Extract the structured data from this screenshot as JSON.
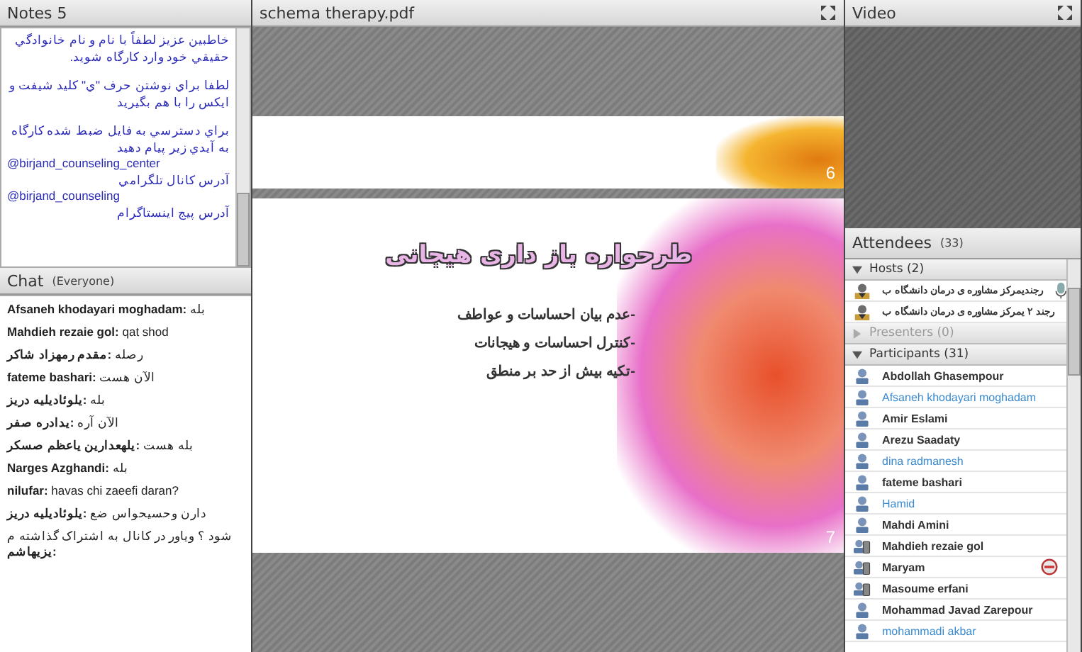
{
  "notes": {
    "title": "Notes 5",
    "paragraphs": [
      {
        "kind": "rtl",
        "text": "خاطبين عزيز لطفاً با نام و نام خانوادگي حقيقي خود وارد کارگاه شويد."
      },
      {
        "kind": "gap"
      },
      {
        "kind": "rtl",
        "text": "لطفا براي نوشتن حرف \"ي\" کليد شيفت و ايکس را با هم بگيريد"
      },
      {
        "kind": "gap"
      },
      {
        "kind": "rtl",
        "text": "براي دسترسي به فايل ضبط شده کارگاه به آيدي زير پيام دهيد"
      },
      {
        "kind": "ltr",
        "text": "@birjand_counseling_center"
      },
      {
        "kind": "rtl",
        "text": "آدرس کانال تلگرامي"
      },
      {
        "kind": "ltr",
        "text": "@birjand_counseling"
      },
      {
        "kind": "rtl",
        "text": "آدرس پيج اينستاگرام"
      }
    ]
  },
  "chat": {
    "title": "Chat",
    "audience": "(Everyone)",
    "messages": [
      "**Afsaneh khodayari moghadam:** بله",
      "**Mahdieh rezaie gol:** qat shod",
      "رصله **:مقدم رمهزاد شاکر**",
      "**fateme bashari:** الآن هست",
      "بله **:یلوئادیلیه دریز**",
      "الآن آره **:یدادره صفر**",
      "بله هست **:یلهعدارین یاعظم صسکر**",
      "**Narges Azghandi:** بله",
      "**nilufar:** havas chi zaeefi daran?",
      "دارن وحسیحواس ضع **:یلوئادیلیه دریز**",
      "شود ؟ ویاور در کانال به اشتراک گذاشته م **:یزیهاشم**"
    ]
  },
  "document": {
    "title": "schema therapy.pdf",
    "pages": [
      {
        "number": "6",
        "kind": "tail"
      },
      {
        "number": "7",
        "kind": "full",
        "title": "طرحواره باز داری هیجانی",
        "bullets": [
          "-عدم بیان احساسات و عواطف",
          "-کنترل احساسات و هیجانات",
          "-تکیه بیش از حد بر منطق"
        ]
      }
    ]
  },
  "video": {
    "title": "Video"
  },
  "attendees": {
    "title": "Attendees",
    "count": "(33)",
    "groups": [
      {
        "label": "Hosts (2)",
        "expanded": true,
        "members": [
          {
            "name": "رجندیمرکز مشاوره ی درمان دانشگاه ب",
            "kind": "host",
            "highlighted": false,
            "speaking": true,
            "blocked": false
          },
          {
            "name": "رجند ۲ یمرکز مشاوره ی درمان دانشگاه ب",
            "kind": "host",
            "highlighted": false,
            "speaking": false,
            "blocked": false
          }
        ]
      },
      {
        "label": "Presenters (0)",
        "expanded": false
      },
      {
        "label": "Participants (31)",
        "expanded": true,
        "members": [
          {
            "name": "Abdollah Ghasempour",
            "kind": "user",
            "highlighted": false,
            "speaking": false,
            "blocked": false
          },
          {
            "name": "Afsaneh khodayari moghadam",
            "kind": "user",
            "highlighted": true,
            "speaking": false,
            "blocked": false
          },
          {
            "name": "Amir Eslami",
            "kind": "user",
            "highlighted": false,
            "speaking": false,
            "blocked": false
          },
          {
            "name": "Arezu Saadaty",
            "kind": "user",
            "highlighted": false,
            "speaking": false,
            "blocked": false
          },
          {
            "name": "dina radmanesh",
            "kind": "user",
            "highlighted": true,
            "speaking": false,
            "blocked": false
          },
          {
            "name": "fateme bashari",
            "kind": "user",
            "highlighted": false,
            "speaking": false,
            "blocked": false
          },
          {
            "name": "Hamid",
            "kind": "user",
            "highlighted": true,
            "speaking": false,
            "blocked": false
          },
          {
            "name": "Mahdi Amini",
            "kind": "user",
            "highlighted": false,
            "speaking": false,
            "blocked": false
          },
          {
            "name": "Mahdieh rezaie gol",
            "kind": "mobile",
            "highlighted": false,
            "speaking": false,
            "blocked": false
          },
          {
            "name": "Maryam",
            "kind": "mobile",
            "highlighted": false,
            "speaking": false,
            "blocked": true
          },
          {
            "name": "Masoume erfani",
            "kind": "mobile",
            "highlighted": false,
            "speaking": false,
            "blocked": false
          },
          {
            "name": "Mohammad Javad Zarepour",
            "kind": "user",
            "highlighted": false,
            "speaking": false,
            "blocked": false
          },
          {
            "name": "mohammadi akbar",
            "kind": "user",
            "highlighted": true,
            "speaking": false,
            "blocked": false
          }
        ]
      }
    ]
  }
}
